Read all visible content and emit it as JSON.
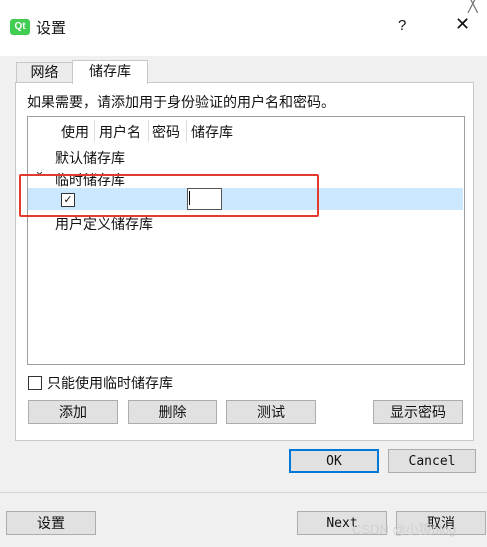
{
  "titlebar": {
    "logo": "Qt",
    "title": "设置",
    "help": "?",
    "close": "✕",
    "outer_close": "╳"
  },
  "tabs": [
    {
      "label": "网络"
    },
    {
      "label": "储存库"
    }
  ],
  "info": "如果需要，请添加用于身份验证的用户名和密码。",
  "tree": {
    "headers": [
      "使用",
      "用户名",
      "密码",
      "储存库"
    ],
    "groups": {
      "default": "默认储存库",
      "temp": "临时储存库",
      "user": "用户定义储存库"
    },
    "expander": "⌄",
    "row_checkbox": "✓"
  },
  "temp_only": {
    "label": "只能使用临时储存库",
    "checked": false
  },
  "buttons": {
    "add": "添加",
    "delete": "删除",
    "test": "测试",
    "show_password": "显示密码",
    "ok": "OK",
    "cancel": "Cancel"
  },
  "bottom": {
    "settings": "设置",
    "next": "Next",
    "cancel": "取消"
  },
  "watermark": "CSDN @小猿blog",
  "colors": {
    "selection": "#cce8ff",
    "highlight_box": "#e23b2e",
    "default_button_border": "#0078d7",
    "qt_green": "#41cd52"
  },
  "icons": {
    "logo": "qt-logo-icon",
    "checkbox": "checkbox-icon",
    "expander": "chevron-down-icon"
  }
}
